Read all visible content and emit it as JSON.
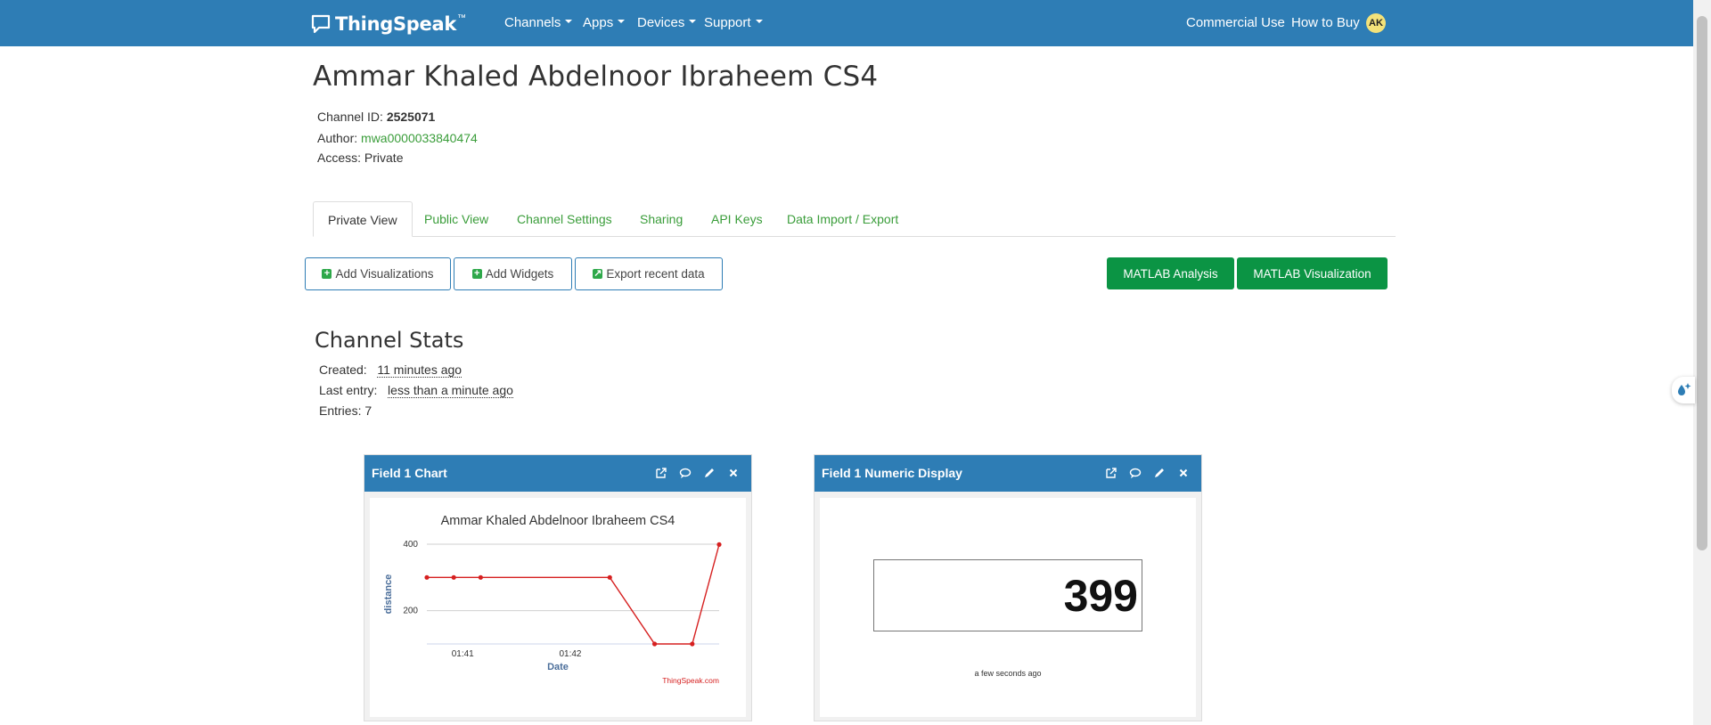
{
  "navbar": {
    "brand": "ThingSpeak",
    "brand_tm": "™",
    "menu": [
      {
        "label": "Channels"
      },
      {
        "label": "Apps"
      },
      {
        "label": "Devices"
      },
      {
        "label": "Support"
      }
    ],
    "right": [
      {
        "label": "Commercial Use"
      },
      {
        "label": "How to Buy"
      }
    ],
    "avatar": "AK",
    "color": "#2e7db5"
  },
  "channel": {
    "title": "Ammar Khaled Abdelnoor Ibraheem CS4",
    "id_label": "Channel ID:",
    "id_value": "2525071",
    "author_label": "Author:",
    "author_value": "mwa0000033840474",
    "access_label": "Access:",
    "access_value": "Private"
  },
  "tabs": [
    {
      "label": "Private View",
      "active": true
    },
    {
      "label": "Public View"
    },
    {
      "label": "Channel Settings"
    },
    {
      "label": "Sharing"
    },
    {
      "label": "API Keys"
    },
    {
      "label": "Data Import / Export"
    }
  ],
  "toolbar": {
    "add_visualizations": "Add Visualizations",
    "add_widgets": "Add Widgets",
    "export_recent": "Export recent data",
    "matlab_analysis": "MATLAB Analysis",
    "matlab_visualization": "MATLAB Visualization"
  },
  "stats": {
    "title": "Channel Stats",
    "created_label": "Created:",
    "created_value": "11 minutes ago",
    "last_entry_label": "Last entry:",
    "last_entry_value": "less than a minute ago",
    "entries_label": "Entries:",
    "entries_value": "7"
  },
  "widgets": {
    "chart": {
      "header": "Field 1 Chart",
      "icons": [
        "external-link-icon",
        "comment-icon",
        "pencil-icon",
        "close-icon"
      ]
    },
    "numeric": {
      "header": "Field 1 Numeric Display",
      "value": "399",
      "timestamp": "a few seconds ago",
      "icons": [
        "external-link-icon",
        "comment-icon",
        "pencil-icon",
        "close-icon"
      ]
    }
  },
  "chart_data": {
    "type": "line",
    "title": "Ammar Khaled Abdelnoor Ibraheem CS4",
    "xlabel": "Date",
    "ylabel": "distance",
    "credit": "ThingSpeak.com",
    "x_ticks": [
      "01:41",
      "01:42"
    ],
    "y_ticks": [
      200,
      400
    ],
    "ylim": [
      100,
      400
    ],
    "grid": true,
    "line_color": "#d62020",
    "series": [
      {
        "x": [
          "01:40:40",
          "01:40:55",
          "01:41:10",
          "01:42:22",
          "01:42:47",
          "01:43:08",
          "01:43:23"
        ],
        "values": [
          300,
          300,
          300,
          300,
          100,
          100,
          399
        ]
      }
    ]
  }
}
